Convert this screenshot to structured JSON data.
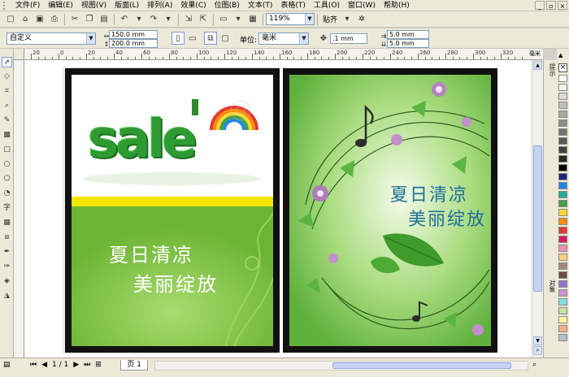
{
  "menu": {
    "items": [
      "文件(F)",
      "编辑(E)",
      "视图(V)",
      "版面(L)",
      "排列(A)",
      "效果(C)",
      "位图(B)",
      "文本(T)",
      "表格(T)",
      "工具(O)",
      "窗口(W)",
      "帮助(H)"
    ]
  },
  "window_controls": [
    "_",
    "▫",
    "×"
  ],
  "toolbar": {
    "zoom": "119%",
    "snap_label": "贴齐"
  },
  "property_bar": {
    "paper_preset": "自定义",
    "width": "150.0 mm",
    "height": "200.0 mm",
    "unit_label": "单位:",
    "unit": "毫米",
    "nudge": ".1 mm",
    "dup_x": "5.0 mm",
    "dup_y": "5.0 mm"
  },
  "ruler": {
    "unit": "毫米",
    "labels": [
      "20",
      "0",
      "20",
      "40",
      "60",
      "80",
      "100",
      "120",
      "140",
      "160",
      "180",
      "200",
      "220",
      "240",
      "260",
      "280",
      "300",
      "320"
    ]
  },
  "docker": {
    "tab1": "提示",
    "tab2": "对象"
  },
  "statusbar": {
    "page_counter": "1 / 1",
    "page_tab": "页 1"
  },
  "poster_left": {
    "headline": "sale",
    "slogan_line1": "夏日清凉",
    "slogan_line2": "美丽绽放",
    "bg_color": "#7cc242",
    "stripe_color": "#f5e600"
  },
  "poster_right": {
    "slogan_line1": "夏日清凉",
    "slogan_line2": "美丽绽放",
    "bg_color": "#8fd06a",
    "text_color": "#1f6f9a"
  },
  "palette_colors": [
    "#ffffff",
    "#f2f2f2",
    "#d9d9d9",
    "#bfbfbf",
    "#a6a6a6",
    "#8c8c8c",
    "#737373",
    "#595959",
    "#404040",
    "#262626",
    "#000000",
    "#1a237e",
    "#1e88e5",
    "#26a69a",
    "#43a047",
    "#fdd835",
    "#fb8c00",
    "#e53935",
    "#d81b60",
    "#f48fb1",
    "#ffcc80",
    "#a1887f",
    "#6d4c41",
    "#9575cd",
    "#ce93d8",
    "#80deea",
    "#c5e1a5",
    "#fff59d",
    "#ffab91",
    "#b0bec5"
  ]
}
